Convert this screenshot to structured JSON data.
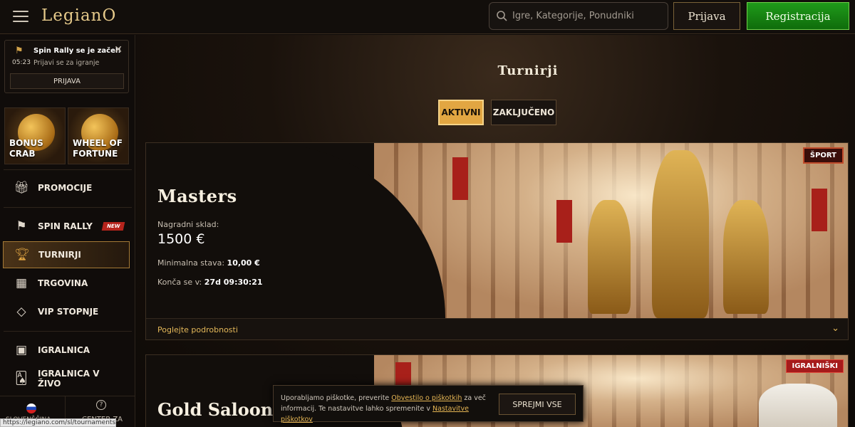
{
  "header": {
    "logo": "LegianO",
    "search_placeholder": "Igre, Kategorije, Ponudniki",
    "login": "Prijava",
    "register": "Registracija"
  },
  "notification": {
    "title": "Spin Rally se je začel!",
    "time": "05:23",
    "subtitle": "Prijavi se za igranje",
    "button": "PRIJAVA"
  },
  "promos": [
    {
      "label_line1": "BONUS",
      "label_line2": "CRAB"
    },
    {
      "label_line1": "WHEEL OF",
      "label_line2": "FORTUNE"
    }
  ],
  "nav": {
    "promotions": "PROMOCIJE",
    "spin_rally": "SPIN RALLY",
    "new_badge": "NEW",
    "tournaments": "TURNIRJI",
    "shop": "TRGOVINA",
    "vip": "VIP STOPNJE",
    "casino": "IGRALNICA",
    "live_casino_1": "IGRALNICA V",
    "live_casino_2": "ŽIVO"
  },
  "footer": {
    "language": "SLOVENŠČINA",
    "help": "CENTER ZA"
  },
  "status_url": "https://legiano.com/sl/tournaments",
  "main": {
    "title": "Turnirji",
    "tab_active": "AKTIVNI",
    "tab_finished": "ZAKLJUČENO"
  },
  "tournament1": {
    "name": "Masters",
    "category": "ŠPORT",
    "prize_label": "Nagradni sklad:",
    "prize_value": "1500 €",
    "min_bet_label": "Minimalna stava:",
    "min_bet_value": "10,00 €",
    "ends_label": "Konča se v:",
    "ends_value": "27d 09:30:21",
    "details": "Poglejte podrobnosti"
  },
  "tournament2": {
    "name": "Gold Saloon",
    "category": "IGRALNIŠKI"
  },
  "cookie": {
    "text1": "Uporabljamo piškotke, preverite ",
    "link1": "Obvestilo o piškotkih",
    "text2": " za več informacij. Te nastavitve lahko spremenite v ",
    "link2": "Nastavitve piškotkov",
    "button": "SPREJMI VSE"
  },
  "colors": {
    "accent_gold": "#e2a642",
    "register_green": "#1f9a1a",
    "badge_red": "#a61b1b"
  }
}
